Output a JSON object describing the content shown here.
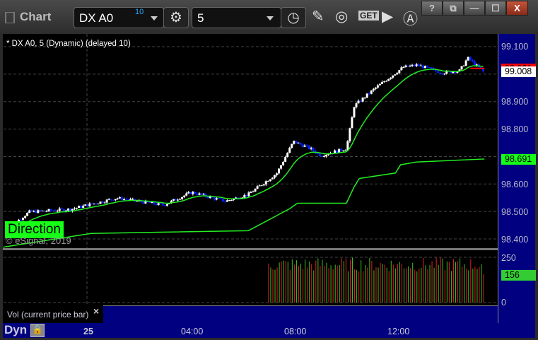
{
  "window": {
    "title": "Chart",
    "buttons": [
      "?",
      "⧉",
      "—",
      "☐",
      "X"
    ]
  },
  "toolbar": {
    "symbol": "DX A0",
    "symbol_badge": "10",
    "interval": "5"
  },
  "chart": {
    "legend": "* DX A0, 5 (Dynamic) (delayed 10)",
    "direction_label": "Direction",
    "copyright": "© eSignal, 2019",
    "price_ticks": [
      "99.100",
      "98.900",
      "98.800",
      "98.600",
      "98.500",
      "98.400"
    ],
    "last_price": "99.008",
    "ma_tag": "99.021",
    "step_tag": "98.691",
    "time_labels": [
      "25",
      "04:00",
      "08:00",
      "12:00"
    ],
    "colors": {
      "up": "#ffffff",
      "down": "#0022ff",
      "ma": "#22ee22",
      "step": "#22ee22",
      "tag_green": "#16ff16",
      "tag_red": "#ff0000"
    }
  },
  "volume": {
    "label": "Vol (current price bar)",
    "close_icon": "×",
    "ticks": [
      "250",
      "0"
    ],
    "last_volume": "156"
  },
  "status": {
    "mode": "Dyn"
  },
  "chart_data": {
    "type": "candlestick",
    "ylim": [
      98.35,
      99.15
    ],
    "price_path": [
      [
        -3.2,
        98.433
      ],
      [
        -2.3,
        98.498
      ],
      [
        -0.7,
        98.508
      ],
      [
        1.1,
        98.549
      ],
      [
        2.9,
        98.523
      ],
      [
        4.0,
        98.57
      ],
      [
        5.3,
        98.537
      ],
      [
        6.2,
        98.562
      ],
      [
        7.3,
        98.639
      ],
      [
        7.95,
        98.755
      ],
      [
        8.6,
        98.729
      ],
      [
        9.0,
        98.704
      ],
      [
        10.0,
        98.729
      ],
      [
        10.3,
        98.884
      ],
      [
        11.1,
        98.948
      ],
      [
        12.2,
        99.025
      ],
      [
        12.75,
        99.033
      ],
      [
        13.7,
        99.005
      ],
      [
        14.4,
        99.013
      ],
      [
        14.7,
        99.059
      ],
      [
        15.35,
        99.005
      ]
    ],
    "step_line": [
      [
        -3.3,
        98.37
      ],
      [
        0.1,
        98.42
      ],
      [
        6.2,
        98.43
      ],
      [
        7.8,
        98.51
      ],
      [
        8.1,
        98.53
      ],
      [
        10.0,
        98.53
      ],
      [
        10.3,
        98.59
      ],
      [
        10.5,
        98.62
      ],
      [
        11.9,
        98.64
      ],
      [
        12.1,
        98.67
      ],
      [
        12.7,
        98.68
      ],
      [
        15.35,
        98.691
      ]
    ],
    "volume_start_hour": 6.9,
    "volume_ylim": [
      0,
      250
    ]
  }
}
